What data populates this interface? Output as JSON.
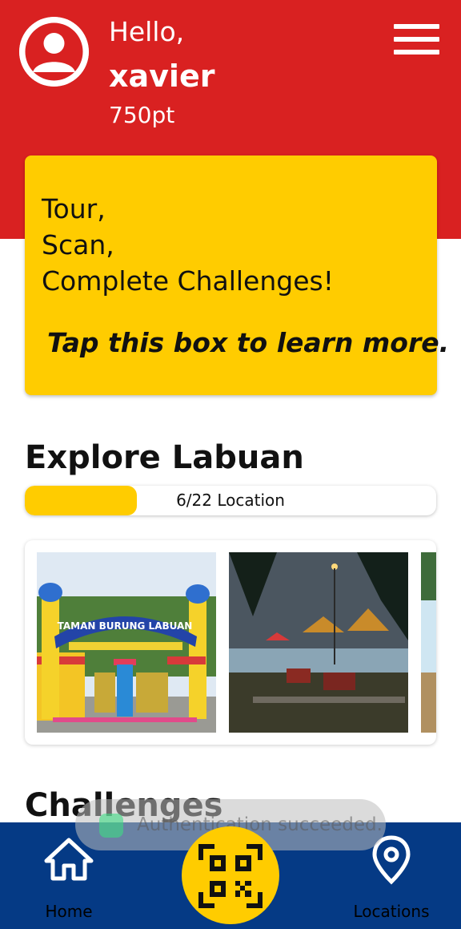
{
  "header": {
    "greeting": "Hello,",
    "username": "xavier",
    "points": "750pt"
  },
  "promo": {
    "lines": [
      "Tour,",
      "Scan,",
      "Complete Challenges!"
    ],
    "cta": "Tap this box to learn more."
  },
  "explore": {
    "title": "Explore Labuan",
    "progress_label": "6/22 Location",
    "visited": 6,
    "total": 22
  },
  "gallery": {
    "gate_sign": "TAMAN BURUNG LABUAN"
  },
  "challenges": {
    "title": "Challenges"
  },
  "toast": {
    "message": "Authentication succeeded."
  },
  "nav": {
    "home_label": "Home",
    "locations_label": "Locations"
  },
  "colors": {
    "header_red": "#d92121",
    "accent_yellow": "#ffcc00",
    "nav_blue": "#053a85"
  }
}
